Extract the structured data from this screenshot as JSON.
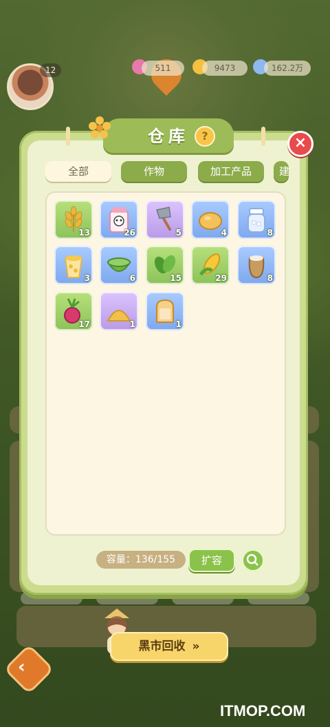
{
  "hud": {
    "level": "12",
    "resource_1": "511",
    "resource_2": "9473",
    "resource_3": "162.2万"
  },
  "dialog": {
    "title": "仓库",
    "help": "?",
    "close": "×"
  },
  "tabs": [
    {
      "label": "全部",
      "active": true
    },
    {
      "label": "作物",
      "active": false
    },
    {
      "label": "加工产品",
      "active": false
    },
    {
      "label": "建",
      "active": false
    }
  ],
  "items": [
    {
      "icon": "wheat-icon",
      "count": "13",
      "bg": "green"
    },
    {
      "icon": "milk-carton-icon",
      "count": "26",
      "bg": "blue"
    },
    {
      "icon": "axe-icon",
      "count": "5",
      "bg": "purple"
    },
    {
      "icon": "bread-loaf-icon",
      "count": "4",
      "bg": "blue"
    },
    {
      "icon": "sugar-jar-icon",
      "count": "8",
      "bg": "blue"
    },
    {
      "icon": "corn-cup-icon",
      "count": "3",
      "bg": "blue"
    },
    {
      "icon": "green-bowl-icon",
      "count": "6",
      "bg": "blue"
    },
    {
      "icon": "leaves-icon",
      "count": "15",
      "bg": "green"
    },
    {
      "icon": "corn-icon",
      "count": "29",
      "bg": "green"
    },
    {
      "icon": "flour-sack-icon",
      "count": "8",
      "bg": "blue"
    },
    {
      "icon": "beet-icon",
      "count": "17",
      "bg": "green"
    },
    {
      "icon": "cornmeal-pile-icon",
      "count": "1",
      "bg": "purple"
    },
    {
      "icon": "toast-icon",
      "count": "1",
      "bg": "blue"
    }
  ],
  "capacity": {
    "label": "容量：136/155",
    "used": 136,
    "total": 155
  },
  "expand_label": "扩容",
  "black_market_label": "黑市回收",
  "watermark": "ITMOP.COM"
}
